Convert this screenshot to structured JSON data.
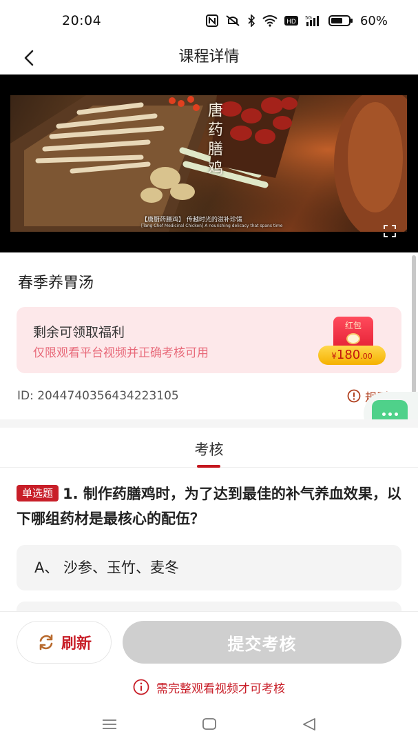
{
  "status_bar": {
    "time": "20:04",
    "battery": "60%",
    "icons": [
      "nfc-icon",
      "mute-icon",
      "bluetooth-icon",
      "wifi-icon",
      "hd-icon",
      "5g-signal-icon",
      "battery-icon"
    ]
  },
  "header": {
    "title": "课程详情",
    "back_icon": "back-arrow-icon"
  },
  "video": {
    "title": "唐药膳鸡",
    "caption_cn": "【唐厨药膳鸡】 传越时光的滋补珍馐",
    "caption_en": "[Tang Chef Medicinal Chicken] A nourishing delicacy that spans time",
    "fullscreen_icon": "fullscreen-icon"
  },
  "course": {
    "title": "春季养胃汤",
    "id_text": "ID: 2044740356434223105",
    "rules_label": "规则"
  },
  "reward": {
    "title": "剩余可领取福利",
    "subtitle": "仅限观看平台视频并正确考核可用",
    "packet_label": "红包",
    "currency": "¥",
    "amount": "180",
    "decimal": ".00"
  },
  "tabs": {
    "exam": "考核"
  },
  "question": {
    "type_badge": "单选题",
    "text": "1. 制作药膳鸡时，为了达到最佳的补气养血效果，以下哪组药材是最核心的配伍？",
    "options": [
      {
        "label": "A、  沙参、玉竹、麦冬"
      }
    ]
  },
  "actions": {
    "refresh_label": "刷新",
    "submit_label": "提交考核",
    "notice": "需完整观看视频才可考核"
  },
  "colors": {
    "accent": "#c81e28",
    "reward_bg": "#fde8ea",
    "reward_subtitle": "#e86a7a",
    "submit_disabled": "#cfcfcf",
    "float_button": "#4fd18a"
  }
}
